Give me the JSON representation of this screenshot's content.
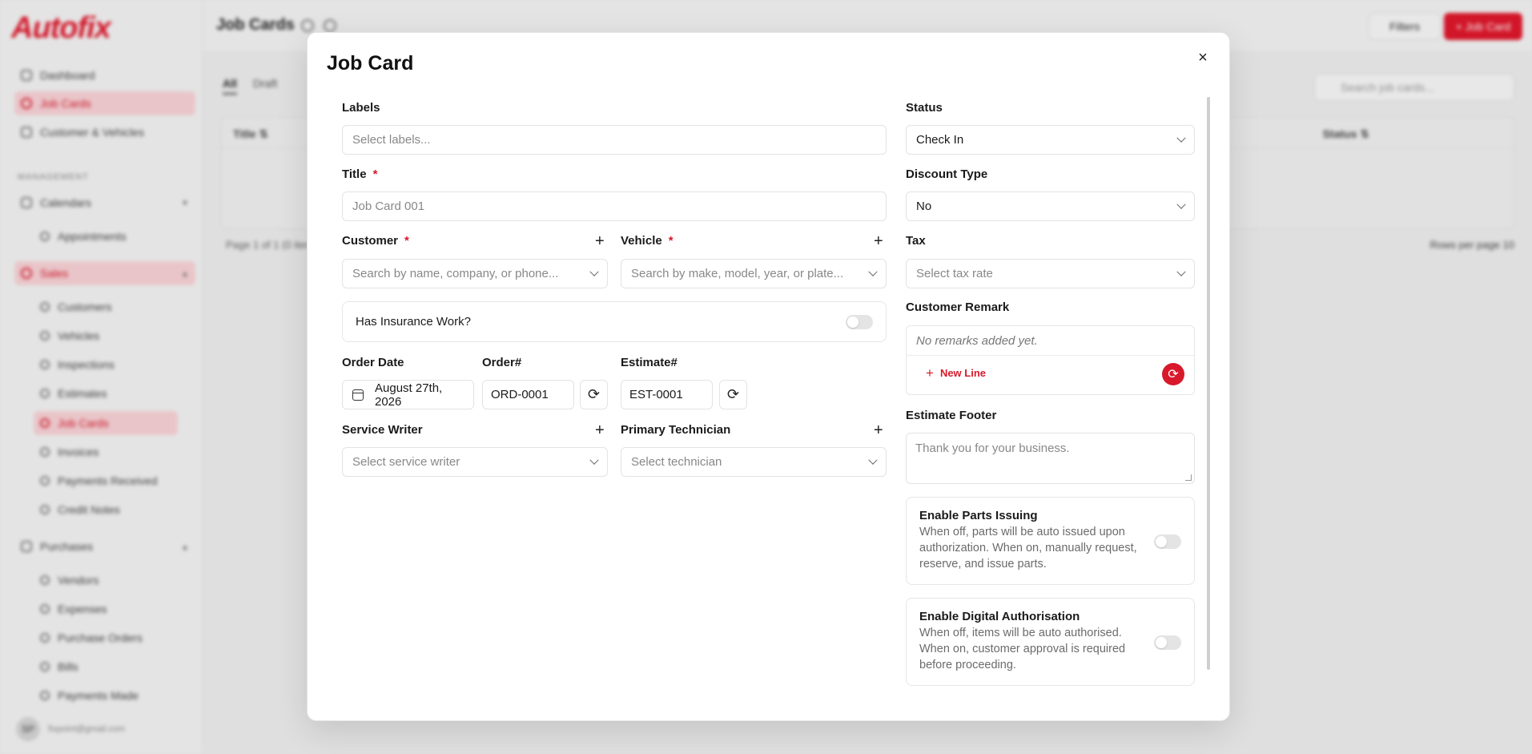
{
  "app": {
    "logo_text": "Autofix",
    "page_title": "Job Cards",
    "filters_label": "Filters",
    "new_label": "+ Job Card",
    "search_placeholder": "Search job cards...",
    "tabs": [
      "All",
      "Draft"
    ],
    "table_headers": {
      "title": "Title ⇅",
      "status": "Status ⇅"
    },
    "pager_left": "Page 1 of 1 (0 items)",
    "pager_right": "Rows per page   10"
  },
  "sidebar": {
    "items": [
      {
        "label": "Dashboard"
      },
      {
        "label": "Job Cards"
      },
      {
        "label": "Customer & Vehicles"
      }
    ],
    "section": "MANAGEMENT",
    "calendars": "Calendars",
    "appointments": "Appointments",
    "sales": "Sales",
    "sales_items": [
      "Customers",
      "Vehicles",
      "Inspections",
      "Estimates",
      "Job Cards",
      "Invoices",
      "Payments Received",
      "Credit Notes"
    ],
    "purchases": "Purchases",
    "purchase_items": [
      "Vendors",
      "Expenses",
      "Purchase Orders",
      "Bills",
      "Payments Made"
    ],
    "user_initials": "SP",
    "user_email": "fixpoint@gmail.com"
  },
  "modal": {
    "title": "Job Card",
    "close_icon": "×",
    "labels_label": "Labels",
    "labels_placeholder": "Select labels...",
    "title_label": "Title",
    "title_placeholder": "Job Card 001",
    "required_mark": "*",
    "customer_label": "Customer",
    "customer_placeholder": "Search by name, company, or phone...",
    "vehicle_label": "Vehicle",
    "vehicle_placeholder": "Search by make, model, year, or plate...",
    "insurance_label": "Has Insurance Work?",
    "order_date_label": "Order Date",
    "order_date_value": "August 27th, 2026",
    "order_no_label": "Order#",
    "order_no_value": "ORD-0001",
    "estimate_no_label": "Estimate#",
    "estimate_no_value": "EST-0001",
    "service_writer_label": "Service Writer",
    "service_writer_placeholder": "Select service writer",
    "technician_label": "Primary Technician",
    "technician_placeholder": "Select technician",
    "status_label": "Status",
    "status_value": "Check In",
    "discount_label": "Discount Type",
    "discount_value": "No",
    "tax_label": "Tax",
    "tax_placeholder": "Select tax rate",
    "remark_label": "Customer Remark",
    "remark_empty": "No remarks added yet.",
    "new_line_label": "New Line",
    "footer_label": "Estimate Footer",
    "footer_placeholder": "Thank you for your business.",
    "parts_title": "Enable Parts Issuing",
    "parts_desc": "When off, parts will be auto issued upon authorization. When on, manually request, reserve, and issue parts.",
    "digital_title": "Enable Digital Authorisation",
    "digital_desc": "When off, items will be auto authorised. When on, customer approval is required before proceeding.",
    "plus_symbol": "+",
    "refresh_symbol": "⟳"
  },
  "colors": {
    "accent": "#d8192b",
    "border": "#e3e3e3"
  }
}
